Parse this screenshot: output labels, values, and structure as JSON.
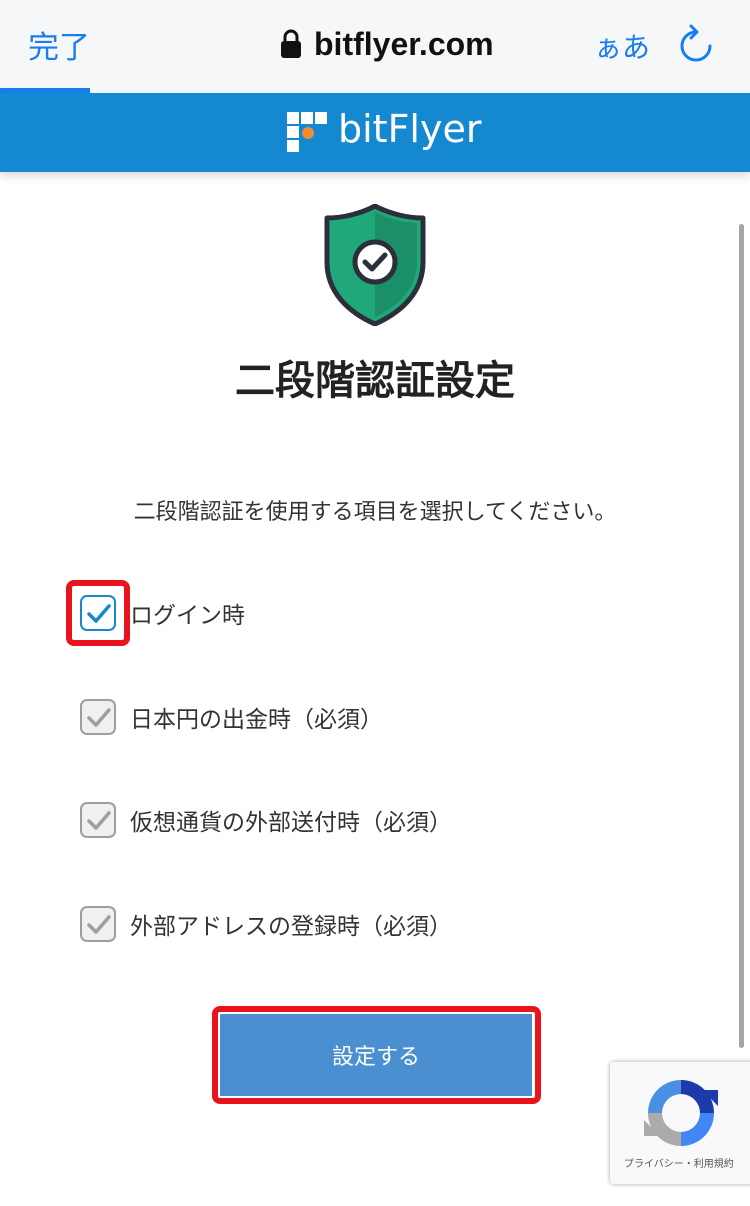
{
  "browser": {
    "done_label": "完了",
    "url": "bitflyer.com",
    "text_size_label": "ぁあ",
    "accent_color": "#1a7cf0"
  },
  "header": {
    "logo_text": "bitFlyer",
    "background_color": "#1489d2"
  },
  "page": {
    "title": "二段階認証設定",
    "instruction": "二段階認証を使用する項目を選択してください。",
    "options": [
      {
        "label": "ログイン時",
        "checked": true,
        "enabled": true
      },
      {
        "label": "日本円の出金時（必須）",
        "checked": true,
        "enabled": false
      },
      {
        "label": "仮想通貨の外部送付時（必須）",
        "checked": true,
        "enabled": false
      },
      {
        "label": "外部アドレスの登録時（必須）",
        "checked": true,
        "enabled": false
      }
    ],
    "submit_label": "設定する"
  },
  "recaptcha": {
    "links": "プライバシー・利用規約"
  },
  "highlight_color": "#e8141d"
}
